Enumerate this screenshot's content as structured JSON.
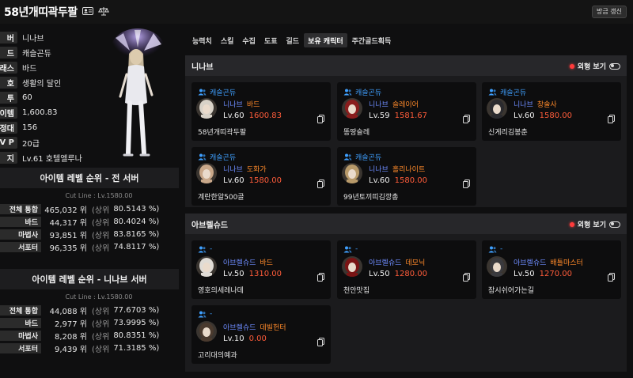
{
  "header": {
    "title": "58년개띠곽두팔",
    "refresh_label": "방금 갱신"
  },
  "profile": {
    "rows": [
      {
        "label": "버",
        "value": "니나브"
      },
      {
        "label": "드",
        "value": "캐슬곤듀"
      },
      {
        "label": "래스",
        "value": "바드"
      },
      {
        "label": "호",
        "value": "생활의 달인"
      },
      {
        "label": "투",
        "value": "60"
      },
      {
        "label": "이템",
        "value": "1,600.83"
      },
      {
        "label": "정대",
        "value": "156"
      },
      {
        "label": "V P",
        "value": "20급"
      },
      {
        "label": "지",
        "value": "Lv.61 호텔엘루나"
      }
    ]
  },
  "rank_all": {
    "title": "아이템 레벨 순위 - 전 서버",
    "cutline": "Cut Line : Lv.1580.00",
    "rows": [
      {
        "label": "전체 통합",
        "rank": "465,032 위",
        "sub": "(상위",
        "pct": "80.5143 %)"
      },
      {
        "label": "바드",
        "rank": "44,317 위",
        "sub": "(상위",
        "pct": "80.4024 %)"
      },
      {
        "label": "마법사",
        "rank": "93,851 위",
        "sub": "(상위",
        "pct": "83.8165 %)"
      },
      {
        "label": "서포터",
        "rank": "96,335 위",
        "sub": "(상위",
        "pct": "74.8117 %)"
      }
    ]
  },
  "rank_server": {
    "title": "아이템 레벨 순위 - 니나브 서버",
    "cutline": "Cut Line : Lv.1580.00",
    "rows": [
      {
        "label": "전체 통합",
        "rank": "44,088 위",
        "sub": "(상위",
        "pct": "77.6703 %)"
      },
      {
        "label": "바드",
        "rank": "2,977 위",
        "sub": "(상위",
        "pct": "73.9995 %)"
      },
      {
        "label": "마법사",
        "rank": "8,208 위",
        "sub": "(상위",
        "pct": "80.8351 %)"
      },
      {
        "label": "서포터",
        "rank": "9,439 위",
        "sub": "(상위",
        "pct": "71.3185 %)"
      }
    ]
  },
  "tabs": [
    "능력치",
    "스킬",
    "수집",
    "도표",
    "길드",
    "보유 캐릭터",
    "주간골드획득"
  ],
  "active_tab": "보유 캐릭터",
  "look_label": "외형 보기",
  "servers": [
    {
      "name": "니나브",
      "characters": [
        {
          "guild": "캐슬곤듀",
          "server": "니나브",
          "class": "바드",
          "level": "Lv.60",
          "item_level": "1600.83",
          "name": "58년개띠곽두팔",
          "hair": "#d8d2c8"
        },
        {
          "guild": "캐슬곤듀",
          "server": "니나브",
          "class": "슬레이어",
          "level": "Lv.59",
          "item_level": "1581.67",
          "name": "똥땅슬레",
          "hair": "#8a1d1d"
        },
        {
          "guild": "캐슬곤듀",
          "server": "니나브",
          "class": "창술사",
          "level": "Lv.60",
          "item_level": "1580.00",
          "name": "신게리김봉춘",
          "hair": "#2a2a2e"
        },
        {
          "guild": "캐슬곤듀",
          "server": "니나브",
          "class": "도화가",
          "level": "Lv.60",
          "item_level": "1580.00",
          "name": "계란한알500골",
          "hair": "#c9a88a"
        },
        {
          "guild": "캐슬곤듀",
          "server": "니나브",
          "class": "홀리나이트",
          "level": "Lv.60",
          "item_level": "1580.00",
          "name": "99년토끼띠김깡총",
          "hair": "#b89a6a"
        }
      ]
    },
    {
      "name": "아브렐슈드",
      "characters": [
        {
          "guild": "-",
          "server": "아브렐슈드",
          "class": "바드",
          "level": "Lv.50",
          "item_level": "1310.00",
          "name": "영호의세레나데",
          "hair": "#e0dcd6"
        },
        {
          "guild": "-",
          "server": "아브렐슈드",
          "class": "데모닉",
          "level": "Lv.50",
          "item_level": "1280.00",
          "name": "천안맛집",
          "hair": "#7a1414"
        },
        {
          "guild": "-",
          "server": "아브렐슈드",
          "class": "배틀마스터",
          "level": "Lv.50",
          "item_level": "1270.00",
          "name": "잠시쉬어가는길",
          "hair": "#3a3a3e"
        },
        {
          "guild": "-",
          "server": "아브렐슈드",
          "class": "데빌헌터",
          "level": "Lv.10",
          "item_level": "0.00",
          "name": "고리대의예과",
          "hair": "#4a3a2e"
        }
      ]
    }
  ],
  "colors": {
    "guild": "#3fa0ff",
    "server": "#6e8cff",
    "class": "#ff8a2a",
    "item_level": "#ff5c3a",
    "look_dot": "#ff3b3b"
  },
  "icons": {
    "title_icons": [
      "id-card-icon",
      "scale-icon"
    ],
    "guild": "users-icon",
    "copy": "copy-icon"
  }
}
